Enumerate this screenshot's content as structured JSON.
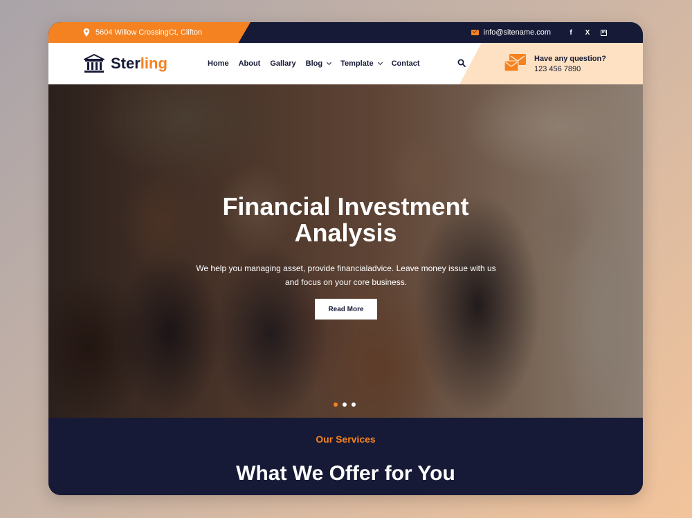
{
  "topbar": {
    "address": "5604 Willow CrossingCt, Clifton",
    "email": "info@sitename.com",
    "social": [
      "f",
      "X",
      "in"
    ]
  },
  "brand": {
    "name_part1": "Ster",
    "name_part2": "ling"
  },
  "nav": {
    "items": [
      {
        "label": "Home"
      },
      {
        "label": "About"
      },
      {
        "label": "Gallary"
      },
      {
        "label": "Blog"
      },
      {
        "label": "Template"
      },
      {
        "label": "Contact"
      }
    ]
  },
  "contact": {
    "question": "Have any question?",
    "phone": "123 456 7890"
  },
  "hero": {
    "title_line1": "Financial Investment",
    "title_line2": "Analysis",
    "subtitle_line1": "We help you managing asset, provide financialadvice. Leave money issue with us",
    "subtitle_line2": "and focus on your core business.",
    "button": "Read More"
  },
  "services": {
    "label": "Our Services",
    "title": "What We Offer for You"
  },
  "colors": {
    "accent": "#f58220",
    "navy": "#161a36",
    "peach": "#fde1c2"
  }
}
